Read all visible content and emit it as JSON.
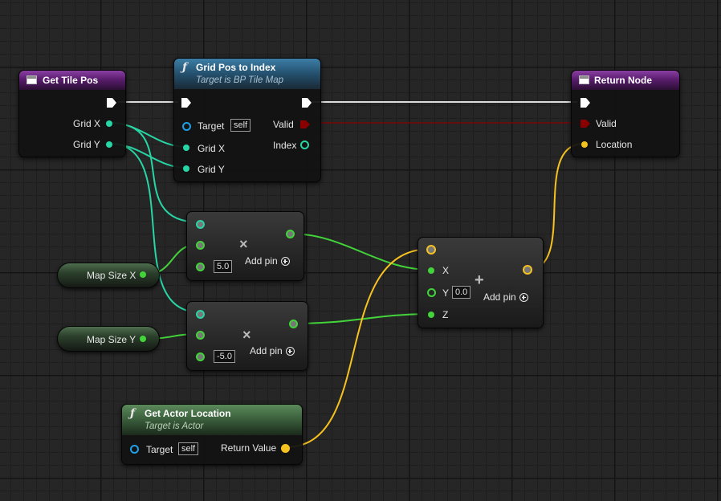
{
  "nodes": {
    "get_tile_pos": {
      "title": "Get Tile Pos",
      "pins": {
        "grid_x": "Grid X",
        "grid_y": "Grid Y"
      }
    },
    "grid_pos_to_index": {
      "title": "Grid Pos to Index",
      "subtitle": "Target is BP Tile Map",
      "inputs": {
        "target": "Target",
        "target_default": "self",
        "grid_x": "Grid X",
        "grid_y": "Grid Y"
      },
      "outputs": {
        "valid": "Valid",
        "index": "Index"
      }
    },
    "return_node": {
      "title": "Return Node",
      "inputs": {
        "valid": "Valid",
        "location": "Location"
      }
    },
    "map_size_x": {
      "label": "Map Size X"
    },
    "map_size_y": {
      "label": "Map Size Y"
    },
    "multiply_1": {
      "symbol": "×",
      "default_value": "5.0",
      "add_pin": "Add pin"
    },
    "multiply_2": {
      "symbol": "×",
      "default_value": "-5.0",
      "add_pin": "Add pin"
    },
    "make_vector": {
      "symbol": "+",
      "x": "X",
      "y": "Y",
      "y_default": "0.0",
      "z": "Z",
      "add_pin": "Add pin"
    },
    "get_actor_location": {
      "title": "Get Actor Location",
      "subtitle": "Target is Actor",
      "target": "Target",
      "target_default": "self",
      "return_value": "Return Value"
    }
  },
  "colors": {
    "exec": "#ffffff",
    "bool": "#8a0000",
    "int": "#27d6a4",
    "float": "#42d43a",
    "vector": "#f5c21f",
    "object": "#1fa0e6"
  }
}
